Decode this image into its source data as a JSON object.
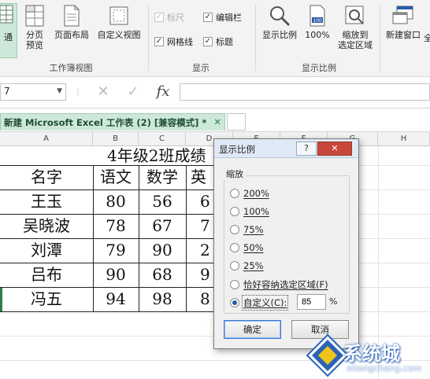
{
  "ribbon": {
    "views_group": {
      "label": "工作簿视图",
      "buttons": [
        {
          "label": "通",
          "icon": "normal-view-icon"
        },
        {
          "label": "分页\n预览",
          "icon": "page-break-preview-icon"
        },
        {
          "label": "页面布局",
          "icon": "page-layout-icon"
        },
        {
          "label": "自定义视图",
          "icon": "custom-views-icon"
        }
      ]
    },
    "show_group": {
      "label": "显示",
      "ruler": "标尺",
      "formula_bar": "编辑栏",
      "gridlines": "网格线",
      "headings": "标题"
    },
    "zoom_group": {
      "label": "显示比例",
      "zoom": "显示比例",
      "zoom100": "100%",
      "zoom_selection": "缩放到\n选定区域"
    },
    "window_group": {
      "new_window": "新建窗口",
      "cut_text": "全"
    }
  },
  "formula_bar": {
    "name_box": "7",
    "cancel": "✕",
    "enter": "✓",
    "fx": "fx"
  },
  "tab": {
    "title": "新建 Microsoft Excel 工作表 (2)  [兼容模式] *",
    "close": "✕"
  },
  "columns": [
    "A",
    "B",
    "C",
    "D",
    "E",
    "F",
    "G",
    "H"
  ],
  "sheet": {
    "title": "4年级2班成绩",
    "headers": [
      "名字",
      "语文",
      "数学",
      "英"
    ],
    "rows": [
      {
        "name": "王玉",
        "chinese": "80",
        "math": "56",
        "english": "6"
      },
      {
        "name": "吴晓波",
        "chinese": "78",
        "math": "67",
        "english": "7"
      },
      {
        "name": "刘潭",
        "chinese": "79",
        "math": "90",
        "english": "2"
      },
      {
        "name": "吕布",
        "chinese": "90",
        "math": "68",
        "english": "9"
      },
      {
        "name": "冯五",
        "chinese": "94",
        "math": "98",
        "english": "8"
      }
    ]
  },
  "dialog": {
    "title": "显示比例",
    "help": "?",
    "close": "✕",
    "group_label": "缩放",
    "options": [
      "200%",
      "100%",
      "75%",
      "50%",
      "25%",
      "恰好容纳选定区域(F)",
      "自定义(C):"
    ],
    "selected_index": 6,
    "custom_value": "85",
    "percent": "%",
    "ok": "确定",
    "cancel": "取消"
  },
  "watermark": {
    "text": "系统城",
    "url": "xitongcheng.com"
  },
  "colors": {
    "accent_green": "#2e7d4f",
    "tab_bg": "#cde8d9",
    "dialog_close": "#c7483a",
    "watermark_blue": "#2b63b6"
  }
}
